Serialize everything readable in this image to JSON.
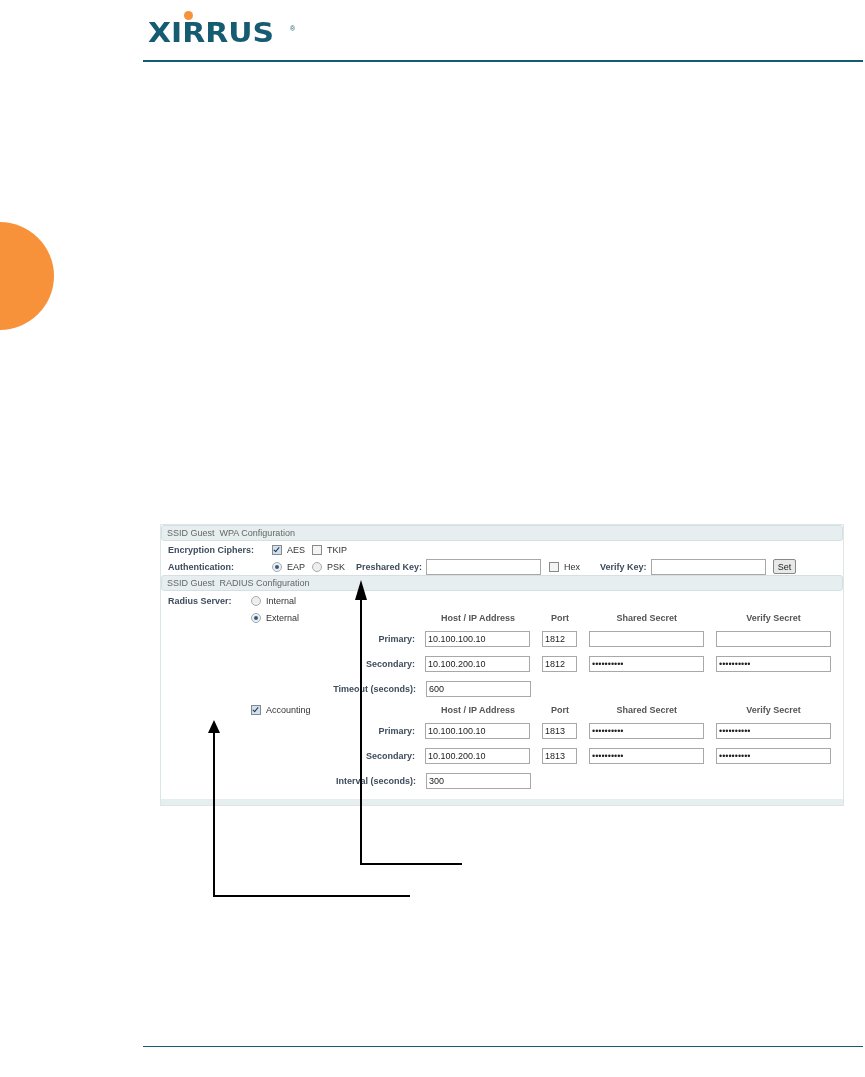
{
  "logo": {
    "text": "XIRRUS",
    "mark": "®"
  },
  "wpa": {
    "title": "SSID Guest  WPA Configuration",
    "ciphers": {
      "label": "Encryption Ciphers:",
      "options": [
        {
          "label": "AES",
          "checked": true
        },
        {
          "label": "TKIP",
          "checked": false
        }
      ]
    },
    "authentication": {
      "label": "Authentication:",
      "options": [
        {
          "label": "EAP",
          "selected": true
        },
        {
          "label": "PSK",
          "selected": false
        }
      ]
    },
    "preshared_key": {
      "label": "Preshared Key:"
    },
    "hex": {
      "label": "Hex",
      "checked": false
    },
    "verify_key": {
      "label": "Verify Key:"
    },
    "button": "Set"
  },
  "radius": {
    "title": "SSID Guest  RADIUS Configuration",
    "server_label": "Radius Server:",
    "server_options": [
      {
        "label": "Internal",
        "selected": false
      },
      {
        "label": "External",
        "selected": true
      }
    ],
    "columns": [
      "Host / IP Address",
      "Port",
      "Shared Secret",
      "Verify Secret"
    ],
    "servers": [
      {
        "label": "Primary:",
        "host": "10.100.100.10",
        "port": "1812"
      },
      {
        "label": "Secondary:",
        "host": "10.100.200.10",
        "port": "1812",
        "shared": "••••••••••",
        "verify": "••••••••••"
      }
    ],
    "timeout": {
      "label": "Timeout (seconds):",
      "value": "600"
    },
    "accounting": {
      "label": "Accounting",
      "checked": true,
      "columns": [
        "Host / IP Address",
        "Port",
        "Shared Secret",
        "Verify Secret"
      ],
      "servers": [
        {
          "label": "Primary:",
          "host": "10.100.100.10",
          "port": "1813",
          "shared": "••••••••••",
          "verify": "••••••••••"
        },
        {
          "label": "Secondary:",
          "host": "10.100.200.10",
          "port": "1813",
          "shared": "••••••••••",
          "verify": "••••••••••"
        }
      ],
      "interval": {
        "label": "Interval (seconds):",
        "value": "300"
      }
    }
  }
}
